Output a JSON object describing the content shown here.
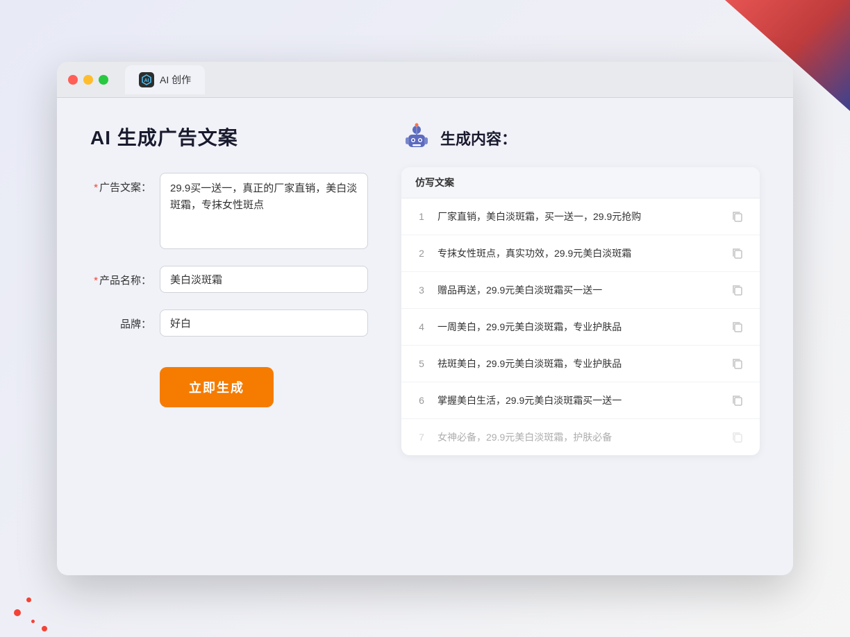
{
  "background": {
    "color": "#e8eaef"
  },
  "browser": {
    "tab_label": "AI 创作",
    "tab_icon_text": "AI"
  },
  "left_panel": {
    "title": "AI 生成广告文案",
    "form": {
      "ad_copy_label": "广告文案：",
      "ad_copy_required": "*",
      "ad_copy_value": "29.9买一送一，真正的厂家直销，美白淡斑霜，专抹女性斑点",
      "product_name_label": "产品名称：",
      "product_name_required": "*",
      "product_name_value": "美白淡斑霜",
      "brand_label": "品牌：",
      "brand_value": "好白"
    },
    "generate_button": "立即生成"
  },
  "right_panel": {
    "title": "生成内容：",
    "table_header": "仿写文案",
    "results": [
      {
        "num": "1",
        "text": "厂家直销，美白淡斑霜，买一送一，29.9元抢购"
      },
      {
        "num": "2",
        "text": "专抹女性斑点，真实功效，29.9元美白淡斑霜"
      },
      {
        "num": "3",
        "text": "赠品再送，29.9元美白淡斑霜买一送一"
      },
      {
        "num": "4",
        "text": "一周美白，29.9元美白淡斑霜，专业护肤品"
      },
      {
        "num": "5",
        "text": "祛斑美白，29.9元美白淡斑霜，专业护肤品"
      },
      {
        "num": "6",
        "text": "掌握美白生活，29.9元美白淡斑霜买一送一"
      },
      {
        "num": "7",
        "text": "女神必备，29.9元美白淡斑霜，护肤必备",
        "faded": true
      }
    ]
  }
}
